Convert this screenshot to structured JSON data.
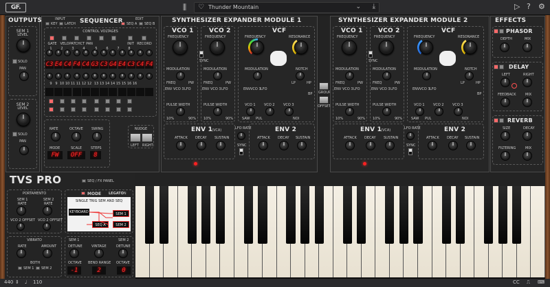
{
  "topbar": {
    "logo": "GF.",
    "library_icon": "library-icon",
    "preset_name": "Thunder Mountain",
    "cv": "CV",
    "icons": [
      "heart-icon",
      "download-icon",
      "play-icon",
      "help-icon",
      "gear-icon"
    ]
  },
  "outputs": {
    "title": "OUTPUTS",
    "sem1": "SEM 1",
    "level1": "LEVEL",
    "solo1": "SOLO",
    "pan1": "PAN",
    "sem2": "SEM 2",
    "level2": "LEVEL",
    "solo2": "SOLO",
    "pan2": "PAN"
  },
  "sequencer": {
    "title": "SEQUENCER",
    "input": "INPUT",
    "key": "KEY",
    "latch": "LATCH",
    "edit": "EDIT",
    "seqa": "SEQ A",
    "seqb": "SEQ B",
    "cv_title": "CONTROL VOLTAGES",
    "cv_buttons": [
      "GATE",
      "VELO",
      "PATCHCT",
      "PAN",
      "",
      "",
      "INIT",
      "RECORD"
    ],
    "row1": [
      "C",
      "3",
      "C",
      "4",
      "C",
      "4",
      "F",
      "C",
      "3",
      "G",
      "4",
      "C",
      "4"
    ],
    "row1_display": [
      "C3",
      "E4",
      "C4",
      "F4",
      "C4",
      "G3",
      "C3",
      "G4",
      "E4",
      "C3",
      "C4",
      "F4"
    ],
    "row2_display": [
      "",
      "",
      "",
      "",
      "",
      "",
      "",
      "",
      "",
      "",
      "",
      ""
    ],
    "steps": [
      "1",
      "2",
      "3",
      "4",
      "5",
      "6",
      "7",
      "8",
      "9",
      "10",
      "11",
      "12",
      "13",
      "14",
      "15",
      "16"
    ],
    "rate": "RATE",
    "octave": "OCTAVE",
    "swing": "SWING",
    "mode": "MODE",
    "scale": "SCALE",
    "steps_label": "STEPS",
    "mode_val": "FW",
    "scale_val": "OFF",
    "steps_val": "8",
    "nudge": "NUDGE",
    "left": "LEFT",
    "right": "RIGHT"
  },
  "module1": {
    "title": "SYNTHESIZER EXPANDER MODULE 1",
    "vco1": "VCO 1",
    "vco2": "VCO 2",
    "vcf": "VCF",
    "frequency": "FREQUENCY",
    "sync": "SYNC",
    "resonance": "RESONANCE",
    "modulation": "MODULATION",
    "freq": "FREQ",
    "pw": "PW",
    "env": "ENV",
    "vco3": "VCO 3",
    "lfo": "LFO",
    "notch": "NOTCH",
    "lp": "LP",
    "hp": "HP",
    "bp": "BP",
    "pulse_width": "PULSE WIDTH",
    "p10": "10%",
    "p50": "50%",
    "p90": "90%",
    "saw": "SAW",
    "pul": "PUL",
    "noi": "NOI",
    "vco3b": "VCO 3",
    "env1": "ENV 1",
    "vca": "(VCA)",
    "env2": "ENV 2",
    "attack": "ATTACK",
    "decay": "DECAY",
    "sustain": "SUSTAIN",
    "lfo_rate": "LFO RATE"
  },
  "module2": {
    "title": "SYNTHESIZER EXPANDER MODULE 2",
    "vco1": "VCO 1",
    "vco2": "VCO 2",
    "vcf": "VCF"
  },
  "center": {
    "group": "GROUP",
    "offset": "OFFSET"
  },
  "effects": {
    "title": "EFFECTS",
    "phasor": "PHASOR",
    "depth": "DEPTH",
    "mix": "MIX",
    "delay": "DELAY",
    "left": "LEFT",
    "right": "RIGHT",
    "feedback": "FEEDBACK",
    "mix2": "MIX",
    "reverb": "REVERB",
    "size": "SIZE",
    "decay": "DECAY",
    "filtering": "FILTERING",
    "mix3": "MIX"
  },
  "lower": {
    "brand": "TVS PRO",
    "seqfx": "SEQ / FX PANEL",
    "portamento": "PORTAMENTO",
    "sem1": "SEM 1",
    "sem2": "SEM 2",
    "rate": "RATE",
    "vco2offset1": "VCO 2 OFFSET",
    "vco2offset2": "VCO 2 OFFSET",
    "mode": "MODE",
    "legato": "LEGATO",
    "on": "ON",
    "single_trig": "SINGLE TRIG SEM AND SEQ",
    "keyboard": "KEYBOARD",
    "seqa": "SEQ A",
    "lsem1": "SEM 1",
    "lsem2": "SEM 2",
    "vibrato": "VIBRATO",
    "vrate": "RATE",
    "amount": "AMOUNT",
    "both": "BOTH",
    "vsem1": "SEM 1",
    "vsem2": "SEM 2",
    "dsem1": "SEM 1",
    "dsem2": "SEM 2",
    "detune": "DETUNE",
    "vintage": "VINTAGE",
    "detune2": "DETUNE",
    "octave": "OCTAVE",
    "bend_range": "BEND RANGE",
    "octave2": "OCTAVE",
    "oct1": "-1",
    "bend": "2",
    "oct2": "0"
  },
  "bottombar": {
    "tuning": "440",
    "bpm": "110",
    "cc": "CC"
  }
}
